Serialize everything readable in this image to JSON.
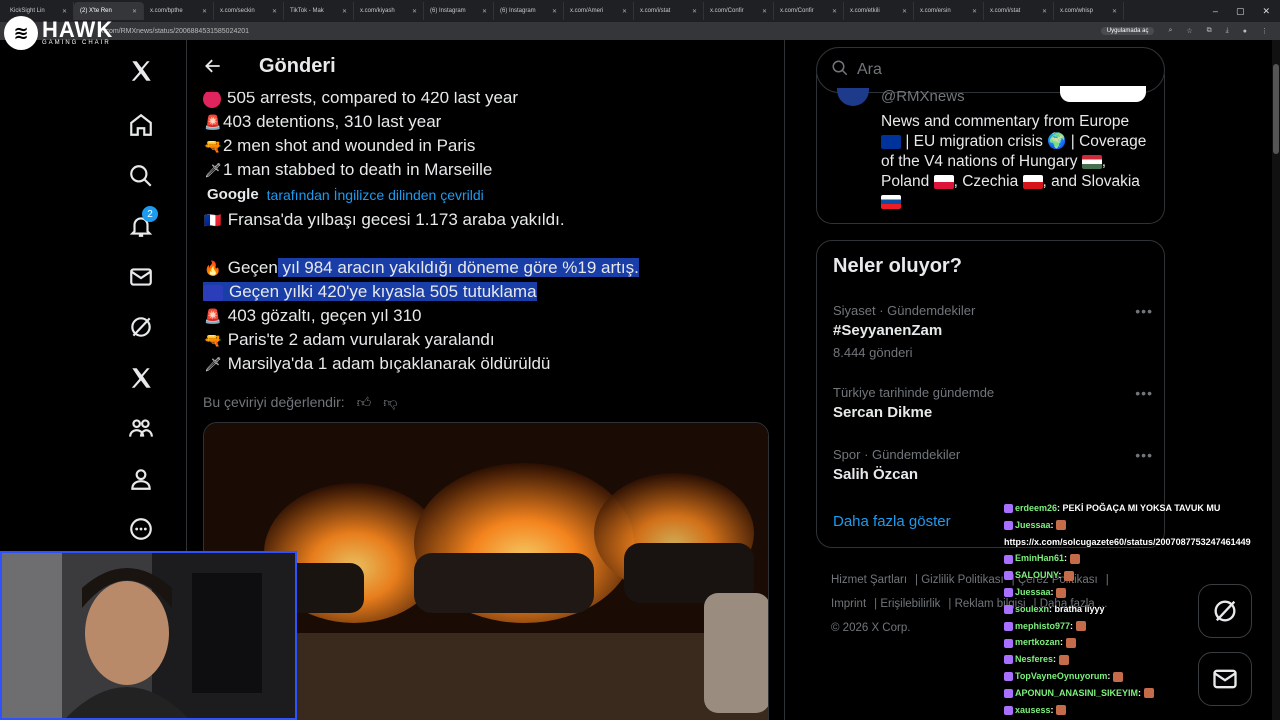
{
  "browser": {
    "tabs": [
      "KickSight Lin",
      "(2) X'te Ren",
      "x.com/bpthe",
      "x.com/seckin",
      "TikTok - Mak",
      "x.com/kiyash",
      "(6) Instagram",
      "(6) Instagram",
      "x.com/Ameri",
      "x.com/i/stat",
      "x.com/Confir",
      "x.com/Confir",
      "x.com/etkili",
      "x.com/ersin",
      "x.com/i/stat",
      "x.com/whisp"
    ],
    "url": "x.com/RMXnews/status/2006884531585024201",
    "app_button": "Uygulamada aç"
  },
  "overlay_logo": {
    "name": "HAWK",
    "sub": "GAMING CHAIR"
  },
  "nav": {
    "notification_count": "2",
    "items": [
      "x-logo-icon",
      "home-icon",
      "search-icon",
      "notifications-icon",
      "messages-icon",
      "grok-icon",
      "premium-x-icon",
      "communities-icon",
      "profile-icon",
      "more-icon"
    ]
  },
  "post": {
    "header_title": "Gönderi",
    "original_lines": [
      "505 arrests, compared to 420 last year",
      "403 detentions, 310 last year",
      "2 men shot and wounded in Paris",
      "1 man stabbed to death in Marseille"
    ],
    "google_label": "Google",
    "translated_by": "tarafından İngilizce dilinden çevrildi",
    "translated_title": "Fransa'da yılbaşı gecesi 1.173 araba yakıldı.",
    "translated_line1_plain": "Geçen",
    "translated_line1_highlight": " yıl 984 aracın yakıldığı döneme göre %19 artış.",
    "translated_line2": "Geçen yılki 420'ye kıyasla 505 tutuklama",
    "translated_lines": [
      "403 gözaltı, geçen yıl 310",
      "Paris'te 2 adam vurularak yaralandı",
      "Marsilya'da 1 adam bıçaklanarak öldürüldü"
    ],
    "rate_translation": "Bu çeviriyi değerlendir:"
  },
  "search": {
    "placeholder": "Ara"
  },
  "profile_card": {
    "handle": "@RMXnews",
    "bio_line1": "News and commentary from Europe",
    "bio_line2_a": "| EU migration crisis",
    "bio_line2_b": "| Coverage",
    "bio_line3": "of the V4 nations of Hungary",
    "bio_line4_a": "Poland",
    "bio_line4_b": ", Czechia",
    "bio_line4_c": ", and Slovakia"
  },
  "trends": {
    "title": "Neler oluyor?",
    "items": [
      {
        "category": "Siyaset · Gündemdekiler",
        "name": "#SeyyanenZam",
        "count": "8.444 gönderi"
      },
      {
        "category": "Türkiye tarihinde gündemde",
        "name": "Sercan Dikme",
        "count": ""
      },
      {
        "category": "Spor · Gündemdekiler",
        "name": "Salih Özcan",
        "count": ""
      }
    ],
    "show_more": "Daha fazla göster"
  },
  "footer": {
    "links": [
      "Hizmet Şartları",
      "Gizlilik Politikası",
      "Çerez Politikası",
      "Imprint",
      "Erişilebilirlik",
      "Reklam bilgisi",
      "Daha fazla ..."
    ],
    "copyright": "© 2026 X Corp."
  },
  "chat": [
    {
      "user": "erdeem26",
      "msg": ": PEKİ POĞAÇA MI YOKSA TAVUK MU"
    },
    {
      "user": "Juessaa",
      "msg": ":"
    },
    {
      "user": "",
      "msg": "https://x.com/solcugazete60/status/2007087753247461449"
    },
    {
      "user": "EminHan61",
      "msg": ":"
    },
    {
      "user": "SALOUNY",
      "msg": ":"
    },
    {
      "user": "Juessaa",
      "msg": ":"
    },
    {
      "user": "soulexn",
      "msg": ": bratha iiyyy"
    },
    {
      "user": "mephisto977",
      "msg": ":"
    },
    {
      "user": "mertkozan",
      "msg": ":"
    },
    {
      "user": "Nesferes",
      "msg": ":"
    },
    {
      "user": "TopVayneOynuyorum",
      "msg": ":"
    },
    {
      "user": "APONUN_ANASINI_SIKEYIM",
      "msg": ":"
    },
    {
      "user": "xausess",
      "msg": ":"
    }
  ],
  "colors": {
    "accent": "#1d9bf0",
    "highlight": "#1a3ea8",
    "background": "#000000",
    "border": "#2f3336"
  }
}
